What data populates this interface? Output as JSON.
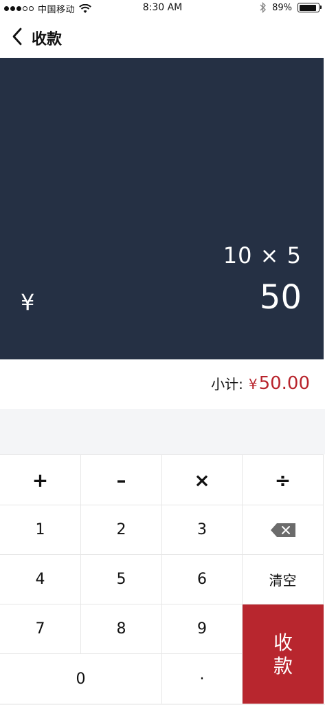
{
  "status_bar": {
    "carrier": "中国移动",
    "time": "8:30 AM",
    "battery": "89%"
  },
  "nav": {
    "title": "收款"
  },
  "display": {
    "expression": "10 × 5",
    "currency_symbol": "¥",
    "result": "50"
  },
  "subtotal": {
    "label": "小计:",
    "currency_symbol": "¥",
    "amount": "50.00"
  },
  "keypad": {
    "plus": "+",
    "minus": "–",
    "multiply": "×",
    "divide": "÷",
    "k1": "1",
    "k2": "2",
    "k3": "3",
    "k4": "4",
    "k5": "5",
    "k6": "6",
    "k7": "7",
    "k8": "8",
    "k9": "9",
    "k0": "0",
    "dot": "·",
    "clear": "清空",
    "pay_line1": "收",
    "pay_line2": "款"
  },
  "colors": {
    "display_bg": "#253044",
    "accent": "#b8242c"
  },
  "icons": {
    "back": "chevron-left-icon",
    "backspace": "backspace-icon",
    "wifi": "wifi-icon",
    "bluetooth": "bluetooth-icon",
    "battery": "battery-icon"
  }
}
